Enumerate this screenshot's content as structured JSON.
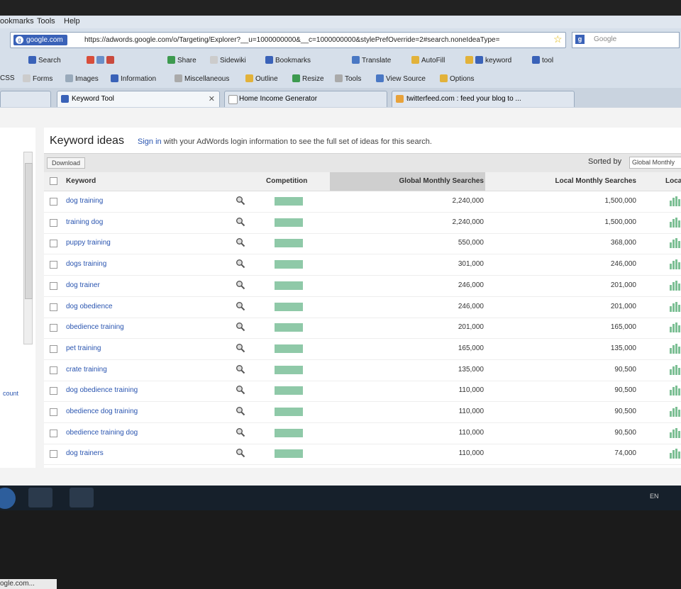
{
  "menu": [
    "ookmarks",
    "Tools",
    "Help"
  ],
  "address": {
    "site": "google.com",
    "url": "https://adwords.google.com/o/Targeting/Explorer?__u=1000000000&__c=1000000000&stylePrefOverride=2#search.noneIdeaType=",
    "search_placeholder": "Google"
  },
  "toolbar1": [
    "Search",
    "Share",
    "Sidewiki",
    "Bookmarks",
    "Translate",
    "AutoFill",
    "keyword",
    "tool"
  ],
  "toolbar2": [
    "CSS",
    "Forms",
    "Images",
    "Information",
    "Miscellaneous",
    "Outline",
    "Resize",
    "Tools",
    "View Source",
    "Options"
  ],
  "tabs": [
    {
      "label": "Keyword Tool",
      "active": true
    },
    {
      "label": "Home Income Generator",
      "active": false
    },
    {
      "label": "twitterfeed.com : feed your blog to ...",
      "active": false
    }
  ],
  "panel": {
    "title": "Keyword ideas",
    "signin_link": "Sign in",
    "signin_rest": "with your AdWords login information to see the full set of ideas for this search.",
    "download": "Download",
    "sorted_by": "Sorted by",
    "sort_value": "Global Monthly"
  },
  "columns": {
    "keyword": "Keyword",
    "competition": "Competition",
    "global": "Global Monthly Searches",
    "local": "Local Monthly Searches",
    "local_trends": "Loca"
  },
  "rows": [
    {
      "keyword": "dog training",
      "global": "2,240,000",
      "local": "1,500,000",
      "competition": 1.0
    },
    {
      "keyword": "training dog",
      "global": "2,240,000",
      "local": "1,500,000",
      "competition": 1.0
    },
    {
      "keyword": "puppy training",
      "global": "550,000",
      "local": "368,000",
      "competition": 1.0
    },
    {
      "keyword": "dogs training",
      "global": "301,000",
      "local": "246,000",
      "competition": 1.0
    },
    {
      "keyword": "dog trainer",
      "global": "246,000",
      "local": "201,000",
      "competition": 1.0
    },
    {
      "keyword": "dog obedience",
      "global": "246,000",
      "local": "201,000",
      "competition": 1.0
    },
    {
      "keyword": "obedience training",
      "global": "201,000",
      "local": "165,000",
      "competition": 1.0
    },
    {
      "keyword": "pet training",
      "global": "165,000",
      "local": "135,000",
      "competition": 1.0
    },
    {
      "keyword": "crate training",
      "global": "135,000",
      "local": "90,500",
      "competition": 1.0
    },
    {
      "keyword": "dog obedience training",
      "global": "110,000",
      "local": "90,500",
      "competition": 1.0
    },
    {
      "keyword": "obedience dog training",
      "global": "110,000",
      "local": "90,500",
      "competition": 1.0
    },
    {
      "keyword": "obedience training dog",
      "global": "110,000",
      "local": "90,500",
      "competition": 1.0
    },
    {
      "keyword": "dog trainers",
      "global": "110,000",
      "local": "74,000",
      "competition": 1.0
    }
  ],
  "left": {
    "link": "count"
  },
  "status": "ogle.com...",
  "taskbar": {
    "lang": "EN"
  }
}
